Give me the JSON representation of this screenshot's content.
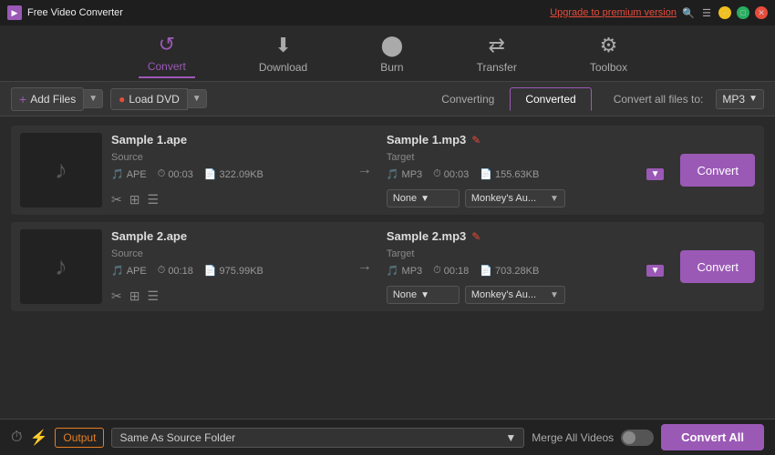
{
  "titleBar": {
    "appName": "Free Video Converter",
    "upgradeText": "Upgrade to premium version",
    "windowControls": [
      "minimize",
      "maximize",
      "close"
    ]
  },
  "nav": {
    "items": [
      {
        "id": "convert",
        "label": "Convert",
        "icon": "↺",
        "active": true
      },
      {
        "id": "download",
        "label": "Download",
        "icon": "⬇",
        "active": false
      },
      {
        "id": "burn",
        "label": "Burn",
        "icon": "⬤",
        "active": false
      },
      {
        "id": "transfer",
        "label": "Transfer",
        "icon": "⇄",
        "active": false
      },
      {
        "id": "toolbox",
        "label": "Toolbox",
        "icon": "⚙",
        "active": false
      }
    ]
  },
  "toolbar": {
    "addFilesLabel": "Add Files",
    "loadDvdLabel": "Load DVD",
    "tabs": [
      {
        "id": "converting",
        "label": "Converting",
        "active": false
      },
      {
        "id": "converted",
        "label": "Converted",
        "active": true
      }
    ],
    "convertAllLabel": "Convert all files to:",
    "convertAllFormat": "MP3"
  },
  "files": [
    {
      "id": "file1",
      "sourceName": "Sample 1.ape",
      "sourceLabel": "Source",
      "sourceFormat": "APE",
      "sourceDuration": "00:03",
      "sourceSize": "322.09KB",
      "targetName": "Sample 1.mp3",
      "targetLabel": "Target",
      "targetFormat": "MP3",
      "targetDuration": "00:03",
      "targetSize": "155.63KB",
      "effectLabel": "None",
      "audioLabel": "Monkey's Au...",
      "convertLabel": "Convert"
    },
    {
      "id": "file2",
      "sourceName": "Sample 2.ape",
      "sourceLabel": "Source",
      "sourceFormat": "APE",
      "sourceDuration": "00:18",
      "sourceSize": "975.99KB",
      "targetName": "Sample 2.mp3",
      "targetLabel": "Target",
      "targetFormat": "MP3",
      "targetDuration": "00:18",
      "targetSize": "703.28KB",
      "effectLabel": "None",
      "audioLabel": "Monkey's Au...",
      "convertLabel": "Convert"
    }
  ],
  "bottomBar": {
    "outputLabel": "Output",
    "outputPath": "Same As Source Folder",
    "mergeLabel": "Merge All Videos",
    "convertAllLabel": "Convert All"
  }
}
